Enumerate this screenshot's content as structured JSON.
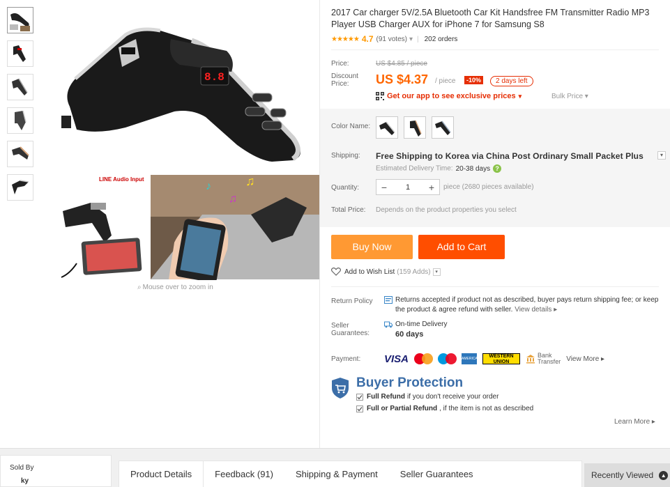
{
  "product": {
    "title": "2017 Car charger 5V/2.5A Bluetooth Car Kit Handsfree FM Transmitter Radio MP3 Player USB Charger AUX for iPhone 7 for Samsung S8",
    "stars_icon": "★★★★★",
    "rating": "4.7",
    "rating_value": 4.7,
    "votes": "(91 votes)",
    "orders": "202 orders"
  },
  "gallery": {
    "thumbnail_count": 6,
    "inset_caption": "LINE Audio Input",
    "zoom_hint": "Mouse over to zoom in"
  },
  "price": {
    "price_label": "Price:",
    "original": "US $4.85 / piece",
    "discount_label": "Discount Price:",
    "current": "US $4.37",
    "per": "/ piece",
    "discount": "-10%",
    "days_left": "2 days left",
    "app_promo": "Get our app to see exclusive prices",
    "bulk": "Bulk Price"
  },
  "options": {
    "color_label": "Color Name:",
    "shipping_label": "Shipping:",
    "shipping_value": "Free Shipping to Korea via China Post Ordinary Small Packet Plus",
    "estimated_label": "Estimated Delivery Time:",
    "estimated_value": "20-38 days",
    "quantity_label": "Quantity:",
    "quantity_value": "1",
    "pieces_available": "piece (2680 pieces available)",
    "total_label": "Total Price:",
    "total_value": "Depends on the product properties you select"
  },
  "actions": {
    "buy_now": "Buy Now",
    "add_to_cart": "Add to Cart",
    "wishlist": "Add to Wish List",
    "wishlist_count": "(159 Adds)"
  },
  "policy": {
    "return_label": "Return Policy",
    "return_text": "Returns accepted if product not as described, buyer pays return shipping fee; or keep the product & agree refund with seller.",
    "view_details": "View details",
    "guarantee_label": "Seller Guarantees:",
    "ontime": "On-time Delivery",
    "days": "60 days",
    "payment_label": "Payment:",
    "visa": "VISA",
    "amex": "AMERICAN EXPRESS",
    "wu_top": "WESTERN",
    "wu_bottom": "UNION",
    "bank_top": "Bank",
    "bank_bottom": "Transfer",
    "view_more": "View More"
  },
  "protection": {
    "title": "Buyer Protection",
    "full_refund": "Full Refund",
    "full_refund_text": "if you don't receive your order",
    "partial_refund": "Full or Partial Refund",
    "partial_refund_text": ", if the item is not as described",
    "learn_more": "Learn More"
  },
  "bottom": {
    "sold_by": "Sold By",
    "seller_partial": "ky",
    "tabs": [
      "Product Details",
      "Feedback (91)",
      "Shipping & Payment",
      "Seller Guarantees"
    ],
    "recently_viewed": "Recently Viewed"
  },
  "colors": {
    "accent_orange": "#ff4e00",
    "buy_orange": "#ff9933",
    "price_orange": "#ff6600",
    "discount_red": "#e62e04",
    "star_orange": "#ff9900",
    "protection_blue": "#3c6ea8"
  },
  "icons": {
    "arrow": "▸",
    "caret": "▾",
    "magnifier": "⌕",
    "minus": "−",
    "plus": "+",
    "question": "?",
    "up": "▲",
    "check": "✓"
  }
}
